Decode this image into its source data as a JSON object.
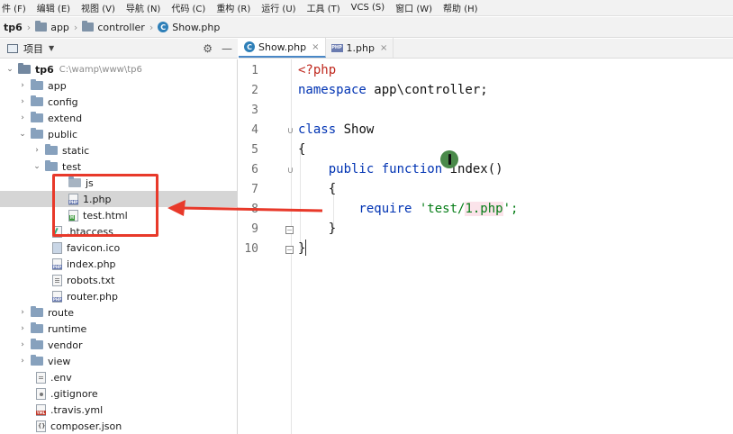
{
  "menubar": {
    "items": [
      "件 (F)",
      "编辑 (E)",
      "视图 (V)",
      "导航 (N)",
      "代码 (C)",
      "重构 (R)",
      "运行 (U)",
      "工具 (T)",
      "VCS (S)",
      "窗口 (W)",
      "帮助 (H)"
    ]
  },
  "breadcrumb": {
    "root": "tp6",
    "items": [
      "app",
      "controller"
    ],
    "file": "Show.php",
    "file_badge": "C"
  },
  "project_panel": {
    "title": "项目",
    "tree": [
      {
        "label": "tp6",
        "path": "C:\\wamp\\www\\tp6"
      },
      {
        "label": "app"
      },
      {
        "label": "config"
      },
      {
        "label": "extend"
      },
      {
        "label": "public"
      },
      {
        "label": "static"
      },
      {
        "label": "test"
      },
      {
        "label": "js"
      },
      {
        "label": "1.php"
      },
      {
        "label": "test.html"
      },
      {
        "label": ".htaccess"
      },
      {
        "label": "favicon.ico"
      },
      {
        "label": "index.php"
      },
      {
        "label": "robots.txt"
      },
      {
        "label": "router.php"
      },
      {
        "label": "route"
      },
      {
        "label": "runtime"
      },
      {
        "label": "vendor"
      },
      {
        "label": "view"
      },
      {
        "label": ".env"
      },
      {
        "label": ".gitignore"
      },
      {
        "label": ".travis.yml"
      },
      {
        "label": "composer.json"
      }
    ]
  },
  "tabs": [
    {
      "label": "Show.php",
      "close": "×"
    },
    {
      "label": "1.php",
      "close": "×"
    }
  ],
  "editor": {
    "line_numbers": [
      "1",
      "2",
      "3",
      "4",
      "5",
      "6",
      "7",
      "8",
      "9",
      "10"
    ],
    "lines": {
      "l1": "<?php",
      "l2a": "namespace",
      "l2b": " app\\controller;",
      "l4a": "class",
      "l4b": " Show",
      "l5": "{",
      "l6a": "    public function",
      "l6b": " index()",
      "l7": "    {",
      "l8a": "        require",
      "l8b": " 'test/",
      "l8c": "1.php",
      "l8d": "';",
      "l9": "    }",
      "l10": "}"
    }
  },
  "colors": {
    "annotation": "#e8392a",
    "keyword": "#0033b3",
    "php_tag": "#c0291f",
    "string": "#067d17"
  }
}
